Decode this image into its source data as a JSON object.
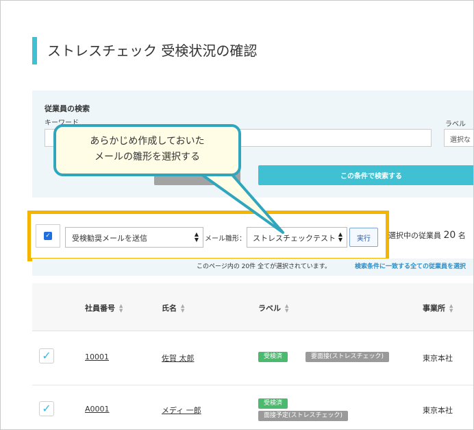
{
  "page": {
    "title": "ストレスチェック 受検状況の確認"
  },
  "search": {
    "heading": "従業員の検索",
    "keyword_label": "キーワード",
    "keyword_value": "",
    "label_label": "ラベル",
    "label_select": "選択な",
    "submit_label": "この条件で検索する"
  },
  "callout": {
    "line1": "あらかじめ作成しておいた",
    "line2": "メールの雛形を選択する"
  },
  "actions": {
    "action_select": "受検勧奨メールを送信",
    "mail_template_label": "メール雛形：",
    "mail_template_select": "ストレスチェックテスト",
    "run_label": "実行",
    "selected_prefix": "選択中の従業員",
    "selected_count": "20",
    "selected_unit": "名"
  },
  "notice": {
    "page_note": "このページ内の 20件 全てが選択されています。",
    "select_all_link": "検索条件に一致する全ての従業員を選択"
  },
  "table": {
    "columns": [
      "社員番号",
      "氏名",
      "ラベル",
      "事業所"
    ],
    "rows": [
      {
        "id": "10001",
        "name": "佐賀 太郎",
        "labels": [
          "受検済",
          "要面接(ストレスチェック)"
        ],
        "office": "東京本社"
      },
      {
        "id": "A0001",
        "name": "メディ 一郎",
        "labels": [
          "受検済",
          "面接予定(ストレスチェック)"
        ],
        "office": "東京本社"
      }
    ]
  },
  "colors": {
    "accent": "#3fc1d3",
    "highlight": "#f5b400",
    "callout_border": "#2fa6bd",
    "badge_green": "#4cba6e",
    "badge_gray": "#9a9a9a"
  }
}
